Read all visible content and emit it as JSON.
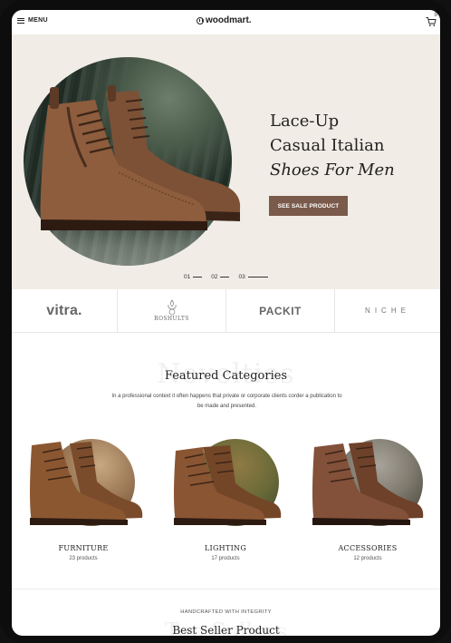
{
  "header": {
    "menu_label": "MENU",
    "logo": "woodmart.",
    "cart_count": "0"
  },
  "hero": {
    "title_line1": "Lace-Up",
    "title_line2": "Casual Italian",
    "title_line3": "Shoes For Men",
    "button_label": "SEE SALE PRODUCT",
    "pager": [
      "01",
      "02",
      "03"
    ]
  },
  "brands": [
    "vitra.",
    "ROSHULTS",
    "PACKIT",
    "NICHE"
  ],
  "featured": {
    "background_word": "Novelties",
    "title": "Featured Categories",
    "description_line1": "In a professional context it often happens that private or corporate clients corder a publication to",
    "description_line2": "be made and presented.",
    "categories": [
      {
        "name": "FURNITURE",
        "count": "23 products"
      },
      {
        "name": "LIGHTING",
        "count": "17 products"
      },
      {
        "name": "ACCESSORIES",
        "count": "12 products"
      }
    ]
  },
  "bestseller": {
    "kicker": "HANDCRAFTED WITH INTEGRITY",
    "background_word": "Top Sellers",
    "title": "Best Seller Product"
  },
  "colors": {
    "accent": "#7a5a4a",
    "hero_bg": "#f1ece6",
    "boot_brown": "#8a5a3c"
  }
}
